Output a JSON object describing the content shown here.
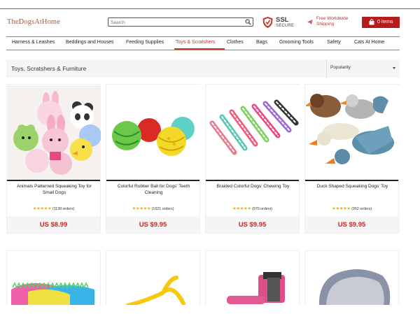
{
  "header": {
    "logo": {
      "pre": "The",
      "paw": "D",
      "post": "ogsAtHome"
    },
    "search": {
      "placeholder": "Search"
    },
    "ssl": {
      "line1": "SSL",
      "line2": "SECURE"
    },
    "shipping": "Free Worldwide Shipping",
    "cart_label": "0 items"
  },
  "nav": {
    "items": [
      {
        "label": "Harness & Leashes"
      },
      {
        "label": "Beddings and Houses"
      },
      {
        "label": "Feeding Supplies"
      },
      {
        "label": "Toys & Scratshers"
      },
      {
        "label": "Clothes"
      },
      {
        "label": "Bags"
      },
      {
        "label": "Grooming Tools"
      },
      {
        "label": "Safety"
      },
      {
        "label": "Cats At Home"
      }
    ],
    "active_index": 3
  },
  "category": {
    "title": "Toys, Scratshers & Furniture",
    "sort_value": "Popularity"
  },
  "products": [
    {
      "name": "Animals Patterned Squeaking Toy for Small Dogs",
      "stars": "★★★★★",
      "orders": "(1138 orders)",
      "price": "US $8.99"
    },
    {
      "name": "Colorful Rubber Ball for Dogs' Teeth Cleaning",
      "stars": "★★★★★",
      "orders": "(1021 orders)",
      "price": "US $9.95"
    },
    {
      "name": "Braided Colorful Dogs' Chewing Toy",
      "stars": "★★★★★",
      "orders": "(970 orders)",
      "price": "US $9.95"
    },
    {
      "name": "Duck Shaped Squeaking Dogs' Toy",
      "stars": "★★★★★",
      "orders": "(952 orders)",
      "price": "US $9.95"
    }
  ],
  "colors": {
    "accent": "#c0392b",
    "price": "#c62828",
    "star": "#f0b400",
    "cart": "#b71c1c"
  }
}
